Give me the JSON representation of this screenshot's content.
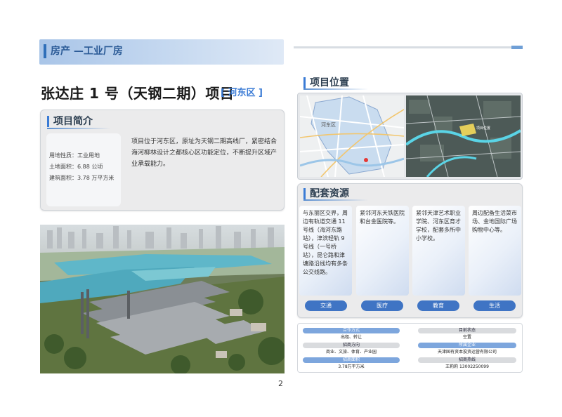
{
  "header": {
    "category": "房产 —工业厂房"
  },
  "project": {
    "title": "张达庄 1 号（天钢二期）项目",
    "district": "[ 河东区 ]"
  },
  "intro": {
    "heading": "项目简介",
    "specs": [
      "用地性质：工业用地",
      "土地面积：6.88 公顷",
      "建筑面积：3.78 万平方米"
    ],
    "text": "项目位于河东区，原址为天钢二期高线厂，紧密结合海河柳林设计之都核心区功能定位，不断提升区域产业承载能力。"
  },
  "location": {
    "heading": "项目位置",
    "map_label": "河东区",
    "sat_label": "项目位置"
  },
  "resources": {
    "heading": "配套资源",
    "cards": [
      {
        "text": "与东丽区交界，周边有轨道交通 11 号线（海河东路站），津滨轻轨 9 号线（一号桥站），昆仑路和津塘路沿线均有多条公交线路。",
        "button": "交通"
      },
      {
        "text": "紧邻河东天铁医院和台金医院等。",
        "button": "医疗"
      },
      {
        "text": "紧邻天津艺术职业学院、河东区育才学校，配套多所中小学校。",
        "button": "教育"
      },
      {
        "text": "周边配备生活菜市场、金地国际广场购物中心等。",
        "button": "生活"
      }
    ]
  },
  "info": {
    "cooperation_label": "合作方式",
    "cooperation_value": "出租、转让",
    "status_label": "目前状态",
    "status_value": "空置",
    "direction_label": "招商方向",
    "direction_value": "商业、文旅、体育、产业园",
    "owner_label": "所属企业",
    "owner_value": "天津国有资本投资运营有限公司",
    "area_label": "招商面积",
    "area_value": "3.78万平方米",
    "hotline_label": "招商热线",
    "hotline_value": "王莉莉 13002250099"
  },
  "page": {
    "number": "2"
  },
  "colors": {
    "accent": "#3a7bd5",
    "button": "#3f74c4",
    "band": "#a9c5e8"
  }
}
